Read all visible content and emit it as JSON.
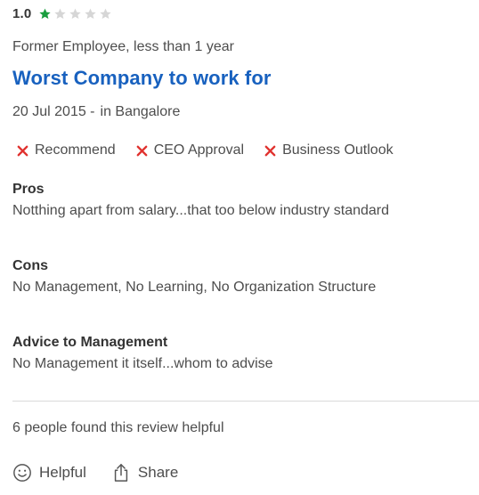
{
  "rating": {
    "value": "1.0",
    "stars_filled": 1,
    "stars_total": 5,
    "filled_color": "#1a9e3f",
    "empty_color": "#d0d0d0"
  },
  "review": {
    "employee_status": "Former Employee, less than 1 year",
    "title": "Worst Company to work for",
    "date": "20 Jul 2015 -",
    "location": "in Bangalore"
  },
  "opinions": [
    {
      "label": "Recommend",
      "icon": "x-icon"
    },
    {
      "label": "CEO Approval",
      "icon": "x-icon"
    },
    {
      "label": "Business Outlook",
      "icon": "x-icon"
    }
  ],
  "pros": {
    "title": "Pros",
    "text": "Notthing apart from salary...that too below industry standard"
  },
  "cons": {
    "title": "Cons",
    "text": "No Management, No Learning, No Organization Structure"
  },
  "advice": {
    "title": "Advice to Management",
    "text": "No Management it itself...whom to advise"
  },
  "helpful_count_text": "6 people found this review helpful",
  "actions": {
    "helpful_label": "Helpful",
    "share_label": "Share"
  },
  "colors": {
    "title_blue": "#1861bf",
    "x_red": "#e0322f"
  }
}
